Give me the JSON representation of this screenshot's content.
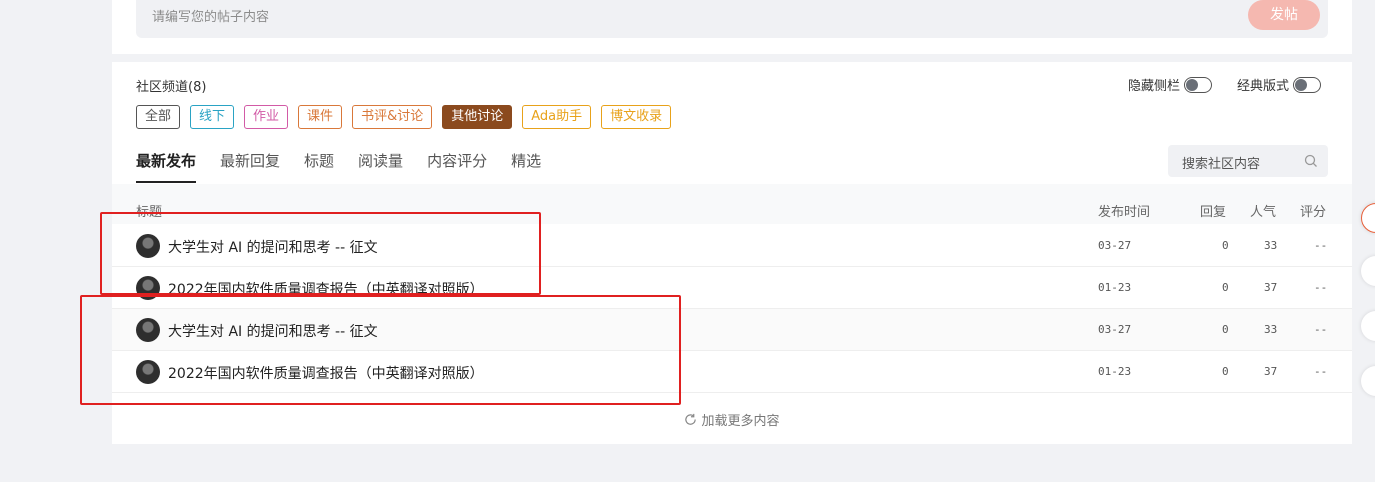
{
  "composer": {
    "placeholder": "请编写您的帖子内容",
    "post_label": "发帖"
  },
  "channel": {
    "title": "社区频道(8)",
    "hide_sidebar_label": "隐藏侧栏",
    "classic_layout_label": "经典版式",
    "tags": [
      {
        "label": "全部",
        "color": "#555555"
      },
      {
        "label": "线下",
        "color": "#2aa3c4"
      },
      {
        "label": "作业",
        "color": "#d25aa6"
      },
      {
        "label": "课件",
        "color": "#d9783a"
      },
      {
        "label": "书评&讨论",
        "color": "#d9783a"
      },
      {
        "label": "其他讨论",
        "color": "#8b4a1e",
        "active": true
      },
      {
        "label": "Ada助手",
        "color": "#e8a21a"
      },
      {
        "label": "博文收录",
        "color": "#e8a21a"
      }
    ]
  },
  "tabs": [
    "最新发布",
    "最新回复",
    "标题",
    "阅读量",
    "内容评分",
    "精选"
  ],
  "search": {
    "placeholder": "搜索社区内容"
  },
  "table": {
    "headers": {
      "title": "标题",
      "time": "发布时间",
      "replies": "回复",
      "popularity": "人气",
      "score": "评分"
    },
    "rows": [
      {
        "title": "大学生对 AI 的提问和思考 -- 征文",
        "time": "03-27",
        "replies": "0",
        "popularity": "33",
        "score": "--"
      },
      {
        "title": "2022年国内软件质量调查报告（中英翻译对照版）",
        "time": "01-23",
        "replies": "0",
        "popularity": "37",
        "score": "--"
      },
      {
        "title": "大学生对 AI 的提问和思考 -- 征文",
        "time": "03-27",
        "replies": "0",
        "popularity": "33",
        "score": "--"
      },
      {
        "title": "2022年国内软件质量调查报告（中英翻译对照版）",
        "time": "01-23",
        "replies": "0",
        "popularity": "37",
        "score": "--"
      }
    ]
  },
  "load_more": "加载更多内容",
  "colors": {
    "accent": "#f5b8b0",
    "highlight": "#e02020"
  }
}
